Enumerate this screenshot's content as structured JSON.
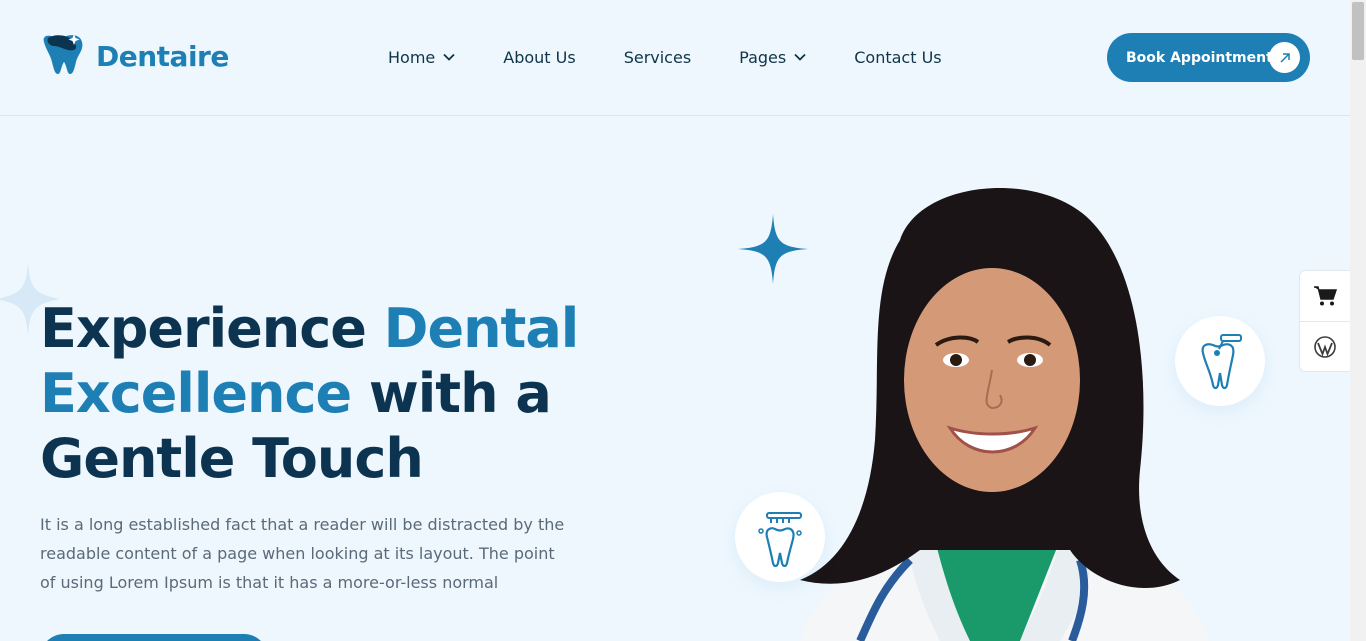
{
  "brand": {
    "name": "Dentaire",
    "color": "#1e7fb4",
    "dark": "#0c3450"
  },
  "nav": {
    "items": [
      {
        "label": "Home",
        "has_dropdown": true
      },
      {
        "label": "About Us",
        "has_dropdown": false
      },
      {
        "label": "Services",
        "has_dropdown": false
      },
      {
        "label": "Pages",
        "has_dropdown": true
      },
      {
        "label": "Contact Us",
        "has_dropdown": false
      }
    ],
    "cta": {
      "label": "Book Appointment",
      "icon": "arrow-up-right-icon"
    }
  },
  "hero": {
    "title_part1": "Experience ",
    "title_highlight1": "Dental",
    "title_highlight2": "Excellence",
    "title_part2": " with a",
    "title_part3": "Gentle Touch",
    "description": "It is a long established fact that a reader will be distracted by the readable content of a page when looking at its layout. The point of using Lorem Ipsum is that it has a more-or-less normal",
    "badges": [
      "tooth-drill-icon",
      "toothbrush-tooth-icon"
    ]
  },
  "side_widget": {
    "items": [
      "cart-icon",
      "wordpress-icon"
    ]
  }
}
